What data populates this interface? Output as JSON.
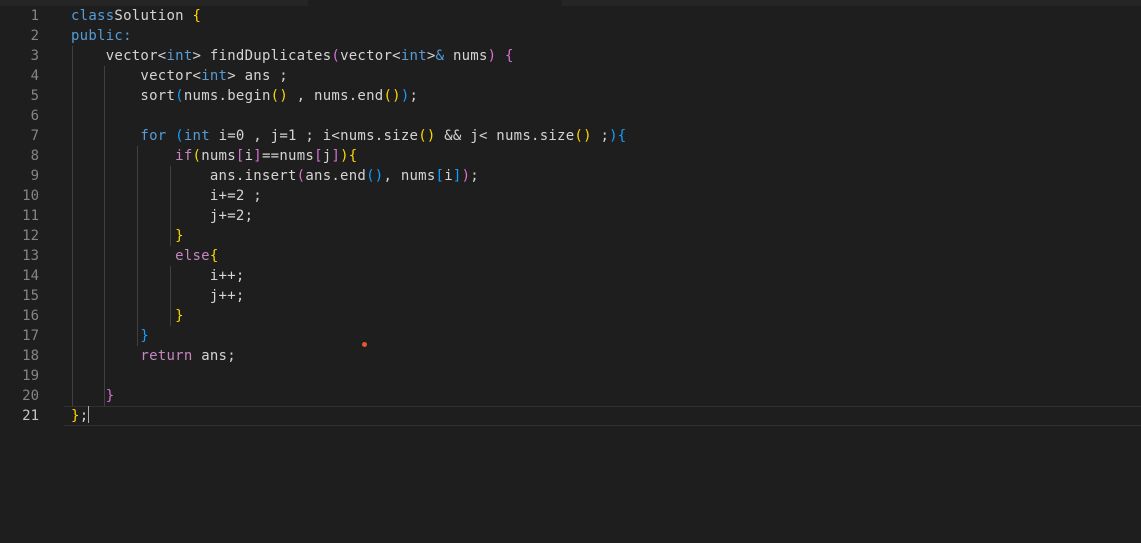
{
  "editor": {
    "language": "cpp",
    "current_line": 21,
    "lines": [
      {
        "n": "1",
        "tokens": [
          [
            "kw",
            "class"
          ],
          [
            "",
            "Solution "
          ],
          [
            "b1",
            "{"
          ]
        ]
      },
      {
        "n": "2",
        "tokens": [
          [
            "kw",
            "public:"
          ]
        ]
      },
      {
        "n": "3",
        "tokens": [
          [
            "",
            "    vector"
          ],
          [
            "",
            "<"
          ],
          [
            "kw",
            "int"
          ],
          [
            "",
            "> findDuplicates"
          ],
          [
            "b2",
            "("
          ],
          [
            "",
            "vector<"
          ],
          [
            "kw",
            "int"
          ],
          [
            "",
            ">"
          ],
          [
            "kw",
            "&"
          ],
          [
            "",
            " nums"
          ],
          [
            "b2",
            ")"
          ],
          [
            "",
            " "
          ],
          [
            "b2",
            "{"
          ]
        ]
      },
      {
        "n": "4",
        "tokens": [
          [
            "",
            "        vector<"
          ],
          [
            "kw",
            "int"
          ],
          [
            "",
            "> ans ;"
          ]
        ]
      },
      {
        "n": "5",
        "tokens": [
          [
            "",
            "        sort"
          ],
          [
            "b3",
            "("
          ],
          [
            "",
            "nums.begin"
          ],
          [
            "b1",
            "()"
          ],
          [
            "",
            " , nums.end"
          ],
          [
            "b1",
            "()"
          ],
          [
            "b3",
            ")"
          ],
          [
            "",
            ";"
          ]
        ]
      },
      {
        "n": "6",
        "tokens": []
      },
      {
        "n": "7",
        "tokens": [
          [
            "kw",
            "        for"
          ],
          [
            "",
            " "
          ],
          [
            "b3",
            "("
          ],
          [
            "kw",
            "int"
          ],
          [
            "",
            " i=0 , j=1 ; i<nums.size"
          ],
          [
            "b1",
            "()"
          ],
          [
            "",
            " && j< nums.size"
          ],
          [
            "b1",
            "()"
          ],
          [
            "",
            " ;"
          ],
          [
            "b3",
            "){"
          ]
        ]
      },
      {
        "n": "8",
        "tokens": [
          [
            "ctl",
            "            if"
          ],
          [
            "b1",
            "("
          ],
          [
            "",
            "nums"
          ],
          [
            "b2",
            "["
          ],
          [
            "",
            "i"
          ],
          [
            "b2",
            "]"
          ],
          [
            "",
            "==nums"
          ],
          [
            "b2",
            "["
          ],
          [
            "",
            "j"
          ],
          [
            "b2",
            "]"
          ],
          [
            "b1",
            "){"
          ]
        ]
      },
      {
        "n": "9",
        "tokens": [
          [
            "",
            "                ans.insert"
          ],
          [
            "b2",
            "("
          ],
          [
            "",
            "ans.end"
          ],
          [
            "b3",
            "()"
          ],
          [
            "",
            ", nums"
          ],
          [
            "b3",
            "["
          ],
          [
            "",
            "i"
          ],
          [
            "b3",
            "]"
          ],
          [
            "b2",
            ")"
          ],
          [
            "",
            ";"
          ]
        ]
      },
      {
        "n": "10",
        "tokens": [
          [
            "",
            "                i+=2 ;"
          ]
        ]
      },
      {
        "n": "11",
        "tokens": [
          [
            "",
            "                j+=2;"
          ]
        ]
      },
      {
        "n": "12",
        "tokens": [
          [
            "b1",
            "            }"
          ]
        ]
      },
      {
        "n": "13",
        "tokens": [
          [
            "ctl",
            "            else"
          ],
          [
            "b1",
            "{"
          ]
        ]
      },
      {
        "n": "14",
        "tokens": [
          [
            "",
            "                i++;"
          ]
        ]
      },
      {
        "n": "15",
        "tokens": [
          [
            "",
            "                j++;"
          ]
        ]
      },
      {
        "n": "16",
        "tokens": [
          [
            "b1",
            "            }"
          ]
        ]
      },
      {
        "n": "17",
        "tokens": [
          [
            "b3",
            "        }"
          ]
        ]
      },
      {
        "n": "18",
        "tokens": [
          [
            "ctl",
            "        return"
          ],
          [
            "",
            " ans;"
          ]
        ]
      },
      {
        "n": "19",
        "tokens": []
      },
      {
        "n": "20",
        "tokens": [
          [
            "b2",
            "    }"
          ]
        ]
      },
      {
        "n": "21",
        "tokens": [
          [
            "b1",
            "}"
          ],
          [
            "",
            ";"
          ]
        ]
      }
    ]
  }
}
